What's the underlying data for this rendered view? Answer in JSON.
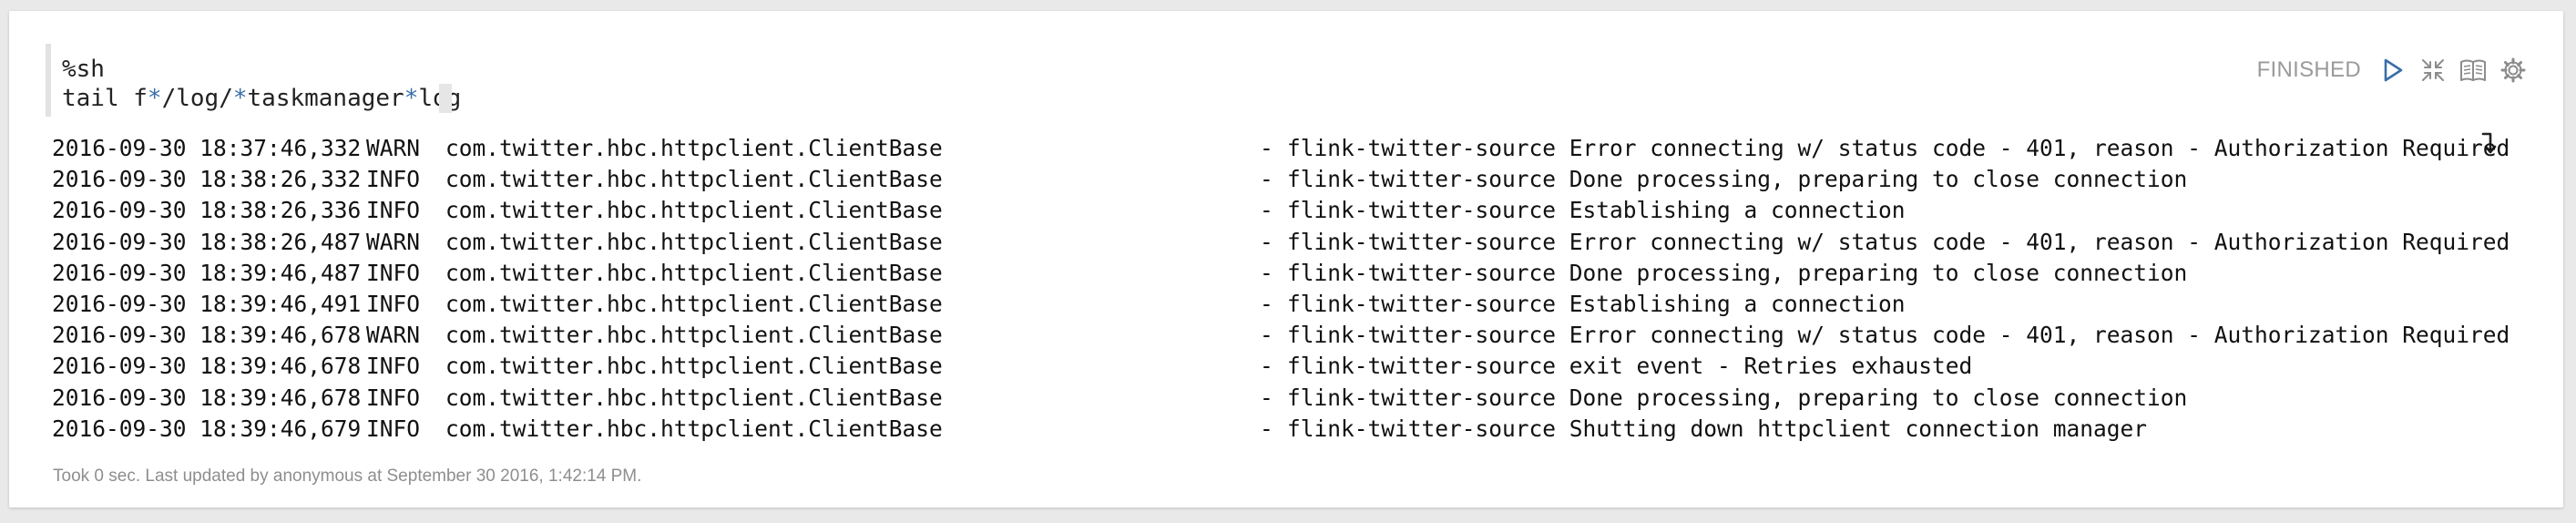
{
  "paragraph": {
    "editor": {
      "line1": "%sh",
      "line2_parts": [
        "tail f",
        "*",
        "/log/",
        "*",
        "taskmanager",
        "*",
        "log"
      ]
    },
    "status": "FINISHED",
    "controls": {
      "icons": [
        "play-icon",
        "collapse-icon",
        "book-icon",
        "gear-icon"
      ]
    },
    "output": {
      "lines": [
        {
          "date": "2016-09-30 18:37:46,332",
          "level": "WARN",
          "class": "com.twitter.hbc.httpclient.ClientBase",
          "dash": "-",
          "message": "flink-twitter-source Error connecting w/ status code - 401, reason - Authorization Required"
        },
        {
          "date": "2016-09-30 18:38:26,332",
          "level": "INFO",
          "class": "com.twitter.hbc.httpclient.ClientBase",
          "dash": "-",
          "message": "flink-twitter-source Done processing, preparing to close connection"
        },
        {
          "date": "2016-09-30 18:38:26,336",
          "level": "INFO",
          "class": "com.twitter.hbc.httpclient.ClientBase",
          "dash": "-",
          "message": "flink-twitter-source Establishing a connection"
        },
        {
          "date": "2016-09-30 18:38:26,487",
          "level": "WARN",
          "class": "com.twitter.hbc.httpclient.ClientBase",
          "dash": "-",
          "message": "flink-twitter-source Error connecting w/ status code - 401, reason - Authorization Required"
        },
        {
          "date": "2016-09-30 18:39:46,487",
          "level": "INFO",
          "class": "com.twitter.hbc.httpclient.ClientBase",
          "dash": "-",
          "message": "flink-twitter-source Done processing, preparing to close connection"
        },
        {
          "date": "2016-09-30 18:39:46,491",
          "level": "INFO",
          "class": "com.twitter.hbc.httpclient.ClientBase",
          "dash": "-",
          "message": "flink-twitter-source Establishing a connection"
        },
        {
          "date": "2016-09-30 18:39:46,678",
          "level": "WARN",
          "class": "com.twitter.hbc.httpclient.ClientBase",
          "dash": "-",
          "message": "flink-twitter-source Error connecting w/ status code - 401, reason - Authorization Required"
        },
        {
          "date": "2016-09-30 18:39:46,678",
          "level": "INFO",
          "class": "com.twitter.hbc.httpclient.ClientBase",
          "dash": "-",
          "message": "flink-twitter-source exit event - Retries exhausted"
        },
        {
          "date": "2016-09-30 18:39:46,678",
          "level": "INFO",
          "class": "com.twitter.hbc.httpclient.ClientBase",
          "dash": "-",
          "message": "flink-twitter-source Done processing, preparing to close connection"
        },
        {
          "date": "2016-09-30 18:39:46,679",
          "level": "INFO",
          "class": "com.twitter.hbc.httpclient.ClientBase",
          "dash": "-",
          "message": "flink-twitter-source Shutting down httpclient connection manager"
        }
      ]
    },
    "footer": "Took 0 sec. Last updated by anonymous at September 30 2016, 1:42:14 PM."
  },
  "colors": {
    "accent": "#3a6ea8",
    "icon": "#8c8c8c",
    "status_text": "#9a9a9a"
  }
}
